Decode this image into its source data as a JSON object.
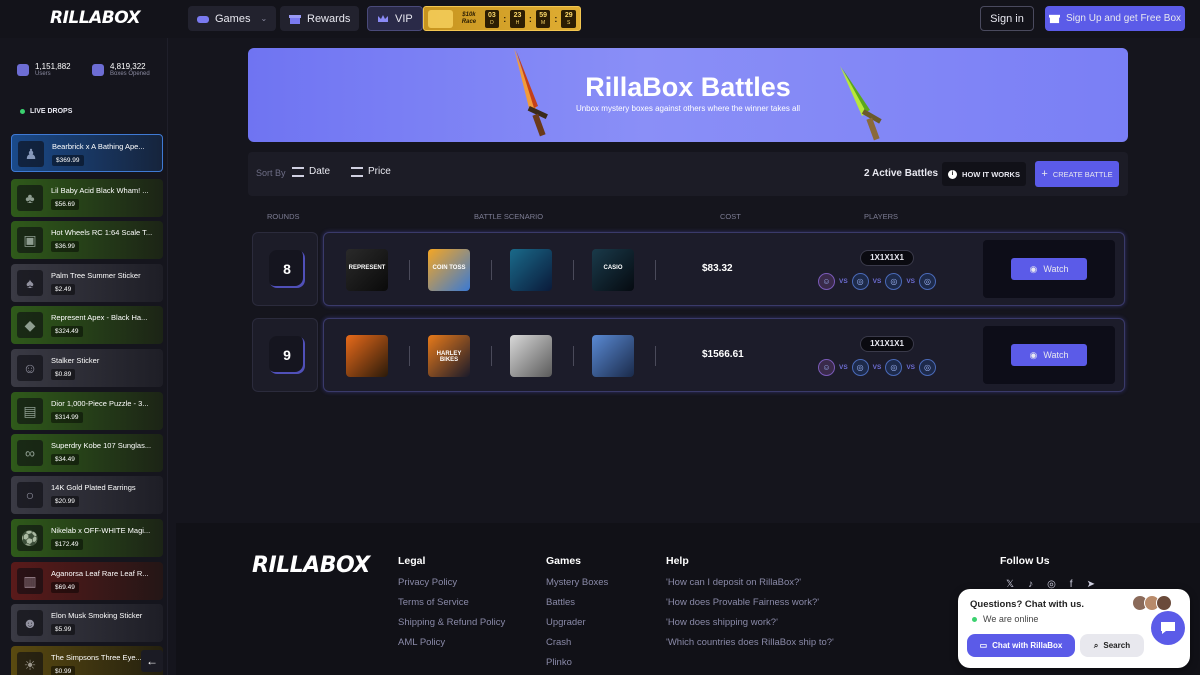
{
  "header": {
    "logo": "RILLABOX",
    "games_label": "Games",
    "rewards_label": "Rewards",
    "vip_label": "VIP",
    "race": {
      "label_line1": "$10k",
      "label_line2": "Race",
      "timer": [
        {
          "value": "03",
          "unit": "D"
        },
        {
          "value": "23",
          "unit": "H"
        },
        {
          "value": "59",
          "unit": "M"
        },
        {
          "value": "29",
          "unit": "S"
        }
      ]
    },
    "signin_label": "Sign in",
    "signup_label": "Sign Up and get Free Box"
  },
  "sidebar": {
    "users_count": "1,151,882",
    "users_label": "Users",
    "boxes_count": "4,819,322",
    "boxes_label": "Boxes Opened",
    "live_drops_label": "LIVE DROPS",
    "drops": [
      {
        "name": "Bearbrick x A Bathing Ape...",
        "price": "$369.99"
      },
      {
        "name": "Lil Baby Acid Black Wham! ...",
        "price": "$56.69"
      },
      {
        "name": "Hot Wheels RC 1:64 Scale T...",
        "price": "$36.99"
      },
      {
        "name": "Palm Tree Summer Sticker",
        "price": "$2.49"
      },
      {
        "name": "Represent Apex - Black Ha...",
        "price": "$324.49"
      },
      {
        "name": "Stalker Sticker",
        "price": "$0.89"
      },
      {
        "name": "Dior 1,000-Piece Puzzle - 3...",
        "price": "$314.99"
      },
      {
        "name": "Superdry Kobe 107 Sunglas...",
        "price": "$34.49"
      },
      {
        "name": "14K Gold Plated Earrings",
        "price": "$20.99"
      },
      {
        "name": "Nikelab x OFF-WHITE Magi...",
        "price": "$172.49"
      },
      {
        "name": "Aganorsa Leaf Rare Leaf R...",
        "price": "$69.49"
      },
      {
        "name": "Elon Musk Smoking Sticker",
        "price": "$5.99"
      },
      {
        "name": "The Simpsons Three Eye...",
        "price": "$0.99"
      }
    ]
  },
  "banner": {
    "title": "RillaBox Battles",
    "subtitle": "Unbox mystery boxes against others where the winner takes all"
  },
  "toolbar": {
    "sort_by_label": "Sort By",
    "sort_date_label": "Date",
    "sort_price_label": "Price",
    "active_battles": "2 Active Battles",
    "how_it_works_label": "HOW IT WORKS",
    "create_battle_label": "CREATE BATTLE"
  },
  "columns": {
    "rounds": "ROUNDS",
    "scenario": "BATTLE SCENARIO",
    "cost": "COST",
    "players": "PLAYERS"
  },
  "battles": [
    {
      "rounds": "8",
      "boxes": [
        "REPRESENT",
        "COIN TOSS",
        "",
        "CASIO"
      ],
      "cost": "$83.32",
      "mode": "1X1X1X1",
      "vs_label": "VS",
      "watch_label": "Watch"
    },
    {
      "rounds": "9",
      "boxes": [
        "",
        "HARLEY BIKES",
        "",
        ""
      ],
      "cost": "$1566.61",
      "mode": "1X1X1X1",
      "vs_label": "VS",
      "watch_label": "Watch"
    }
  ],
  "footer": {
    "logo": "RILLABOX",
    "legal": {
      "heading": "Legal",
      "links": [
        "Privacy Policy",
        "Terms of Service",
        "Shipping & Refund Policy",
        "AML Policy"
      ]
    },
    "games": {
      "heading": "Games",
      "links": [
        "Mystery Boxes",
        "Battles",
        "Upgrader",
        "Crash",
        "Plinko"
      ]
    },
    "help": {
      "heading": "Help",
      "links": [
        "'How can I deposit on RillaBox?'",
        "'How does Provable Fairness work?'",
        "'How does shipping work?'",
        "'Which countries does RillaBox ship to?'"
      ]
    },
    "follow": {
      "heading": "Follow Us",
      "icons": [
        "x-icon",
        "tiktok-icon",
        "instagram-icon",
        "facebook-icon",
        "telegram-icon"
      ]
    }
  },
  "chat": {
    "question": "Questions? Chat with us.",
    "status": "We are online",
    "chat_button": "Chat with RillaBox",
    "search_button": "Search"
  },
  "colors": {
    "accent": "#5b5be8",
    "banner": "#7a7ff5",
    "online": "#3bd16f"
  }
}
